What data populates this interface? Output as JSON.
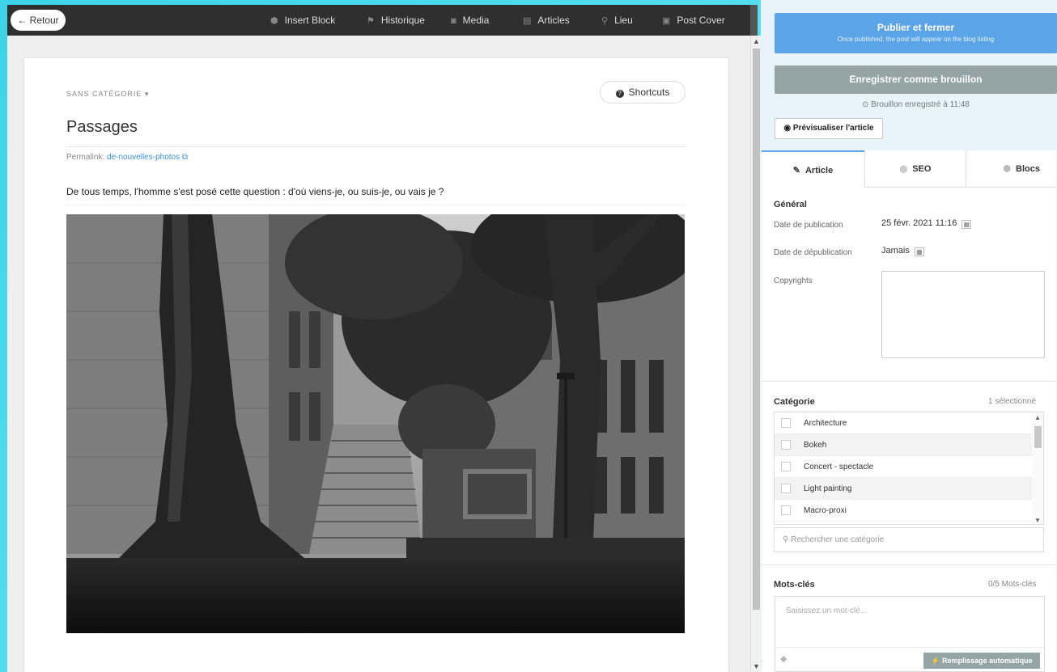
{
  "topbar": {
    "back_label": "← Retour",
    "items": [
      {
        "icon": "cube-icon",
        "label": "Insert Block"
      },
      {
        "icon": "history-icon",
        "label": "Historique"
      },
      {
        "icon": "camera-icon",
        "label": "Media"
      },
      {
        "icon": "file-icon",
        "label": "Articles"
      },
      {
        "icon": "map-marker-icon",
        "label": "Lieu"
      },
      {
        "icon": "image-icon",
        "label": "Post Cover"
      }
    ]
  },
  "editor": {
    "category": "SANS CATÉGORIE ▾",
    "shortcuts_label": "Shortcuts",
    "title": "Passages",
    "permalink_label": "Permalink:",
    "permalink_slug": "de-nouvelles-photos",
    "body_text": "De tous temps, l'homme s'est posé cette question : d'où viens-je, ou suis-je, ou vais je ?",
    "photo_alt": "Black and white photograph of trees and stairs between buildings"
  },
  "sidebar": {
    "publish_label": "Publier et fermer",
    "publish_sub": "Once published, the post will appear on the blog listing",
    "draft_label": "Enregistrer comme brouillon",
    "saved_note": "⊙ Brouillon enregistré à 11:48",
    "preview_label": "Prévisualiser l'article",
    "tabs": [
      {
        "label": "Article",
        "icon": "pencil-icon"
      },
      {
        "label": "SEO",
        "icon": "globe-icon"
      },
      {
        "label": "Blocs",
        "icon": "cube-icon"
      }
    ],
    "general_title": "Général",
    "pub_date_label": "Date de publication",
    "pub_date_value": "25 févr. 2021 11:16",
    "unpub_date_label": "Date de dépublication",
    "unpub_date_value": "Jamais",
    "copyrights_label": "Copyrights",
    "category_title": "Catégorie",
    "category_count": "1 sélectionné",
    "categories": [
      "Architecture",
      "Bokeh",
      "Concert - spectacle",
      "Light painting",
      "Macro-proxi"
    ],
    "category_search_placeholder": "Rechercher une catégorie",
    "keywords_title": "Mots-clés",
    "keywords_count": "0/5 Mots-clés",
    "keywords_placeholder": "Saisissez un mot-clé...",
    "autofill_label": "⚡ Remplissage automatique"
  }
}
